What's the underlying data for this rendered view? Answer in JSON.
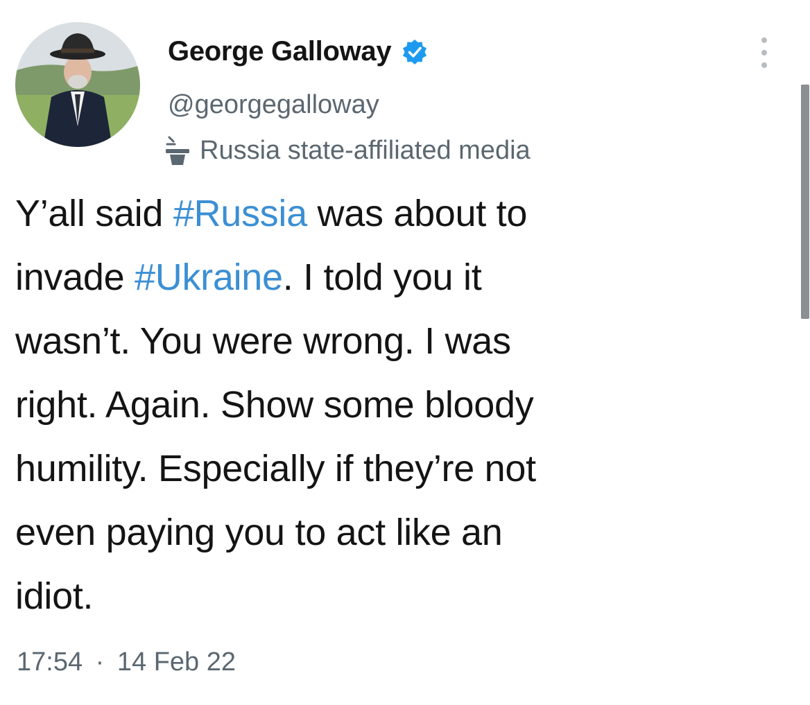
{
  "author": {
    "display_name": "George Galloway",
    "handle": "@georgegalloway",
    "verified_icon": "verified-badge-icon",
    "label_icon": "podium-icon",
    "label": "Russia state-affiliated media"
  },
  "tweet": {
    "lines": [
      [
        {
          "text": "Y’all said "
        },
        {
          "text": "#Russia",
          "hashtag": true
        },
        {
          "text": " was about to"
        }
      ],
      [
        {
          "text": "invade "
        },
        {
          "text": "#Ukraine",
          "hashtag": true
        },
        {
          "text": ". I told you it"
        }
      ],
      [
        {
          "text": "wasn’t. You were wrong. I was"
        }
      ],
      [
        {
          "text": "right. Again. Show some bloody"
        }
      ],
      [
        {
          "text": "humility. Especially if they’re not"
        }
      ],
      [
        {
          "text": "even paying you to act like an"
        }
      ],
      [
        {
          "text": "idiot."
        }
      ]
    ],
    "time": "17:54",
    "separator": "·",
    "date": "14 Feb 22"
  },
  "colors": {
    "text": "#141414",
    "secondary": "#5b6770",
    "hashtag": "#3b8fd4",
    "verified": "#1d9bf0"
  },
  "icons": {
    "more": "more-vertical-icon"
  }
}
